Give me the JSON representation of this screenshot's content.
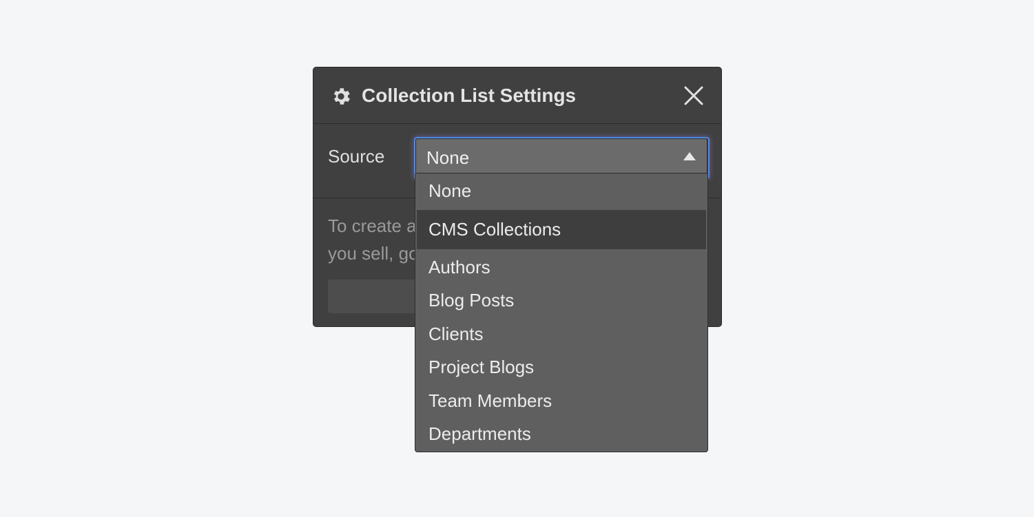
{
  "panel": {
    "title": "Collection List Settings",
    "icon": "gear-icon",
    "close_icon": "close-icon"
  },
  "source": {
    "label": "Source",
    "selected_value": "None",
    "caret_icon": "caret-up-icon"
  },
  "help_text": "To create a Collection List, or lists of products you sell, go to",
  "dropdown": {
    "options": [
      {
        "label": "None",
        "type": "option"
      },
      {
        "label": "CMS Collections",
        "type": "group"
      },
      {
        "label": "Authors",
        "type": "option"
      },
      {
        "label": "Blog Posts",
        "type": "option"
      },
      {
        "label": "Clients",
        "type": "option"
      },
      {
        "label": "Project Blogs",
        "type": "option"
      },
      {
        "label": "Team Members",
        "type": "option"
      },
      {
        "label": "Departments",
        "type": "option"
      }
    ]
  },
  "colors": {
    "background": "#f5f6f8",
    "panel": "#404040",
    "select": "#6b6b6b",
    "dropdown": "#5f5f5f",
    "group_header": "#3e3e3e",
    "focus_ring": "#4a8ae8"
  }
}
